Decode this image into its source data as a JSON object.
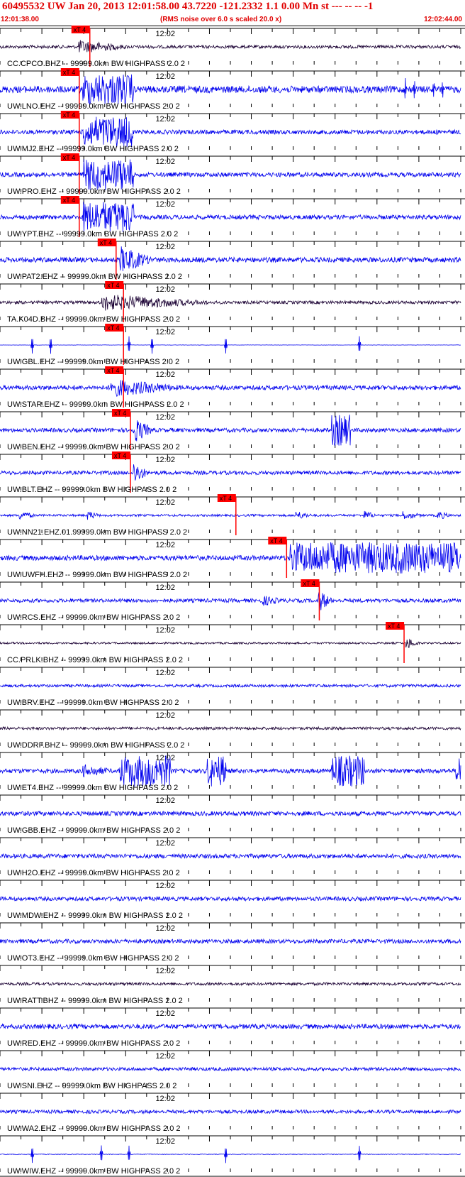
{
  "header": {
    "title": "60495532 UW Jan 20, 2013 12:01:58.00   43.7220 -121.2332  1.1 0.00 Mn st --- -- --   -1",
    "start_time": "12:01:38.00",
    "note": "(RMS noise over 6.0 s scaled 20.0 x)",
    "end_time": "12:02:44.00"
  },
  "colors": {
    "trace_blue": "#0000ee",
    "trace_dark": "#1a0033",
    "pick_red": "#ff0000",
    "header_red": "#e00000"
  },
  "chart_data": {
    "type": "line",
    "x_range": [
      "12:01:38.00",
      "12:02:44.00"
    ],
    "x_mid_label": "12:02",
    "pick_label": "xT 4",
    "channels": [
      {
        "label": "CC.CPCO.BHZ -- 99999.0km BW  HIGHPASS  2.0  2",
        "color": "dark",
        "pick": 0.195,
        "noise": 0.1,
        "bursts": [
          [
            0.17,
            0.28,
            0.45
          ]
        ]
      },
      {
        "label": "UW.LNO.EHZ -- 99999.0km BW  HIGHPASS  2.0  2",
        "color": "blue",
        "pick": 0.172,
        "noise": 0.22,
        "bursts": [
          [
            0.18,
            0.29,
            1.0
          ]
        ],
        "spikes": [
          0.88,
          0.9,
          0.94,
          0.96
        ]
      },
      {
        "label": "UW.MJ2.EHZ -- 99999.0km BW  HIGHPASS  2.0  2",
        "color": "blue",
        "pick": 0.172,
        "noise": 0.14,
        "bursts": [
          [
            0.18,
            0.29,
            1.0
          ]
        ]
      },
      {
        "label": "UW.PRO.EHZ -- 99999.0km BW  HIGHPASS  2.0  2",
        "color": "blue",
        "pick": 0.172,
        "noise": 0.14,
        "bursts": [
          [
            0.18,
            0.29,
            1.0
          ]
        ]
      },
      {
        "label": "UW.YPT.EHZ -- 99999.0km BW  HIGHPASS  2.0  2",
        "color": "blue",
        "pick": 0.172,
        "noise": 0.14,
        "bursts": [
          [
            0.18,
            0.29,
            1.0
          ]
        ]
      },
      {
        "label": "UW.PAT2.EHZ -- 99999.0km BW  HIGHPASS  2.0  2",
        "color": "blue",
        "pick": 0.252,
        "noise": 0.16,
        "bursts": [
          [
            0.26,
            0.33,
            0.9
          ]
        ]
      },
      {
        "label": "TA.K04D.BHZ -- 99999.0km BW  HIGHPASS  2.0  2",
        "color": "dark",
        "pick": 0.268,
        "noise": 0.1,
        "bursts": [
          [
            0.22,
            0.45,
            0.55
          ]
        ]
      },
      {
        "label": "UW.GBL.EHZ -- 99999.0km BW  HIGHPASS  2.0  2",
        "color": "blue",
        "pick": 0.268,
        "noise": 0.01,
        "spikes": [
          0.07,
          0.11,
          0.28,
          0.33,
          0.49,
          0.78
        ]
      },
      {
        "label": "UW.STAR.EHZ -- 99999.0km BW  HIGHPASS  2.0  2",
        "color": "blue",
        "pick": 0.268,
        "noise": 0.14,
        "bursts": [
          [
            0.24,
            0.4,
            0.6
          ]
        ]
      },
      {
        "label": "UW.BEN.EHZ -- 99999.0km BW  HIGHPASS  2.0  2",
        "color": "blue",
        "pick": 0.283,
        "noise": 0.13,
        "bursts": [
          [
            0.29,
            0.33,
            0.85
          ],
          [
            0.72,
            0.76,
            1.0
          ]
        ]
      },
      {
        "label": "UW.BLT.EHZ -- 99999.0km BW  HIGHPASS  2.0  2",
        "color": "blue",
        "pick": 0.283,
        "noise": 0.12,
        "bursts": [
          [
            0.29,
            0.32,
            0.75
          ]
        ]
      },
      {
        "label": "UW.NN21.EHZ.01.99999.0km BW  HIGHPASS  2.0  2",
        "color": "blue",
        "pick": 0.512,
        "noise": 0.07,
        "bursts": [
          [
            0.04,
            0.08,
            0.3
          ],
          [
            0.19,
            0.22,
            0.3
          ],
          [
            0.64,
            0.68,
            0.3
          ],
          [
            0.79,
            0.82,
            0.3
          ],
          [
            0.87,
            0.92,
            0.3
          ],
          [
            0.95,
            0.98,
            0.3
          ]
        ]
      },
      {
        "label": "UW.UWFH.EHZ -- 99999.0km BW  HIGHPASS  2.0  2",
        "color": "blue",
        "pick": 0.622,
        "noise": 0.16,
        "bursts": [
          [
            0.63,
            1.0,
            1.0
          ]
        ]
      },
      {
        "label": "UW.RCS.EHZ -- 99999.0km BW  HIGHPASS  2.0  2",
        "color": "blue",
        "pick": 0.693,
        "noise": 0.12,
        "bursts": [
          [
            0.57,
            0.62,
            0.35
          ],
          [
            0.69,
            0.72,
            0.75
          ]
        ]
      },
      {
        "label": "CC.PRLK.BHZ -- 99999.0km BW  HIGHPASS  2.0  2",
        "color": "dark",
        "pick": 0.877,
        "noise": 0.06,
        "bursts": [
          [
            0.88,
            0.91,
            0.4
          ]
        ]
      },
      {
        "label": "UW.BRV.EHZ -- 99999.0km BW  HIGHPASS  2.0  2",
        "color": "blue",
        "pick": null,
        "noise": 0.09
      },
      {
        "label": "UW.DDRF.BHZ -- 99999.0km BW  HIGHPASS  2.0  2",
        "color": "dark",
        "pick": null,
        "noise": 0.09
      },
      {
        "label": "UW.ET4.EHZ -- 99999.0km BW  HIGHPASS  2.0  2",
        "color": "blue",
        "pick": null,
        "noise": 0.14,
        "bursts": [
          [
            0.18,
            0.25,
            0.45
          ],
          [
            0.26,
            0.37,
            1.0
          ],
          [
            0.45,
            0.49,
            1.0
          ],
          [
            0.72,
            0.79,
            1.0
          ],
          [
            0.99,
            1.0,
            1.0
          ]
        ]
      },
      {
        "label": "UW.GBB.EHZ -- 99999.0km BW  HIGHPASS  2.0  2",
        "color": "blue",
        "pick": null,
        "noise": 0.14
      },
      {
        "label": "UW.H2O.EHZ -- 99999.0km BW  HIGHPASS  2.0  2",
        "color": "blue",
        "pick": null,
        "noise": 0.14
      },
      {
        "label": "UW.MDW.EHZ -- 99999.0km BW  HIGHPASS  2.0  2",
        "color": "blue",
        "pick": null,
        "noise": 0.13
      },
      {
        "label": "UW.OT3.EHZ -- 99999.0km BW  HIGHPASS  2.0  2",
        "color": "blue",
        "pick": null,
        "noise": 0.13
      },
      {
        "label": "UW.RATT.BHZ -- 99999.0km BW  HIGHPASS  2.0  2",
        "color": "dark",
        "pick": null,
        "noise": 0.09
      },
      {
        "label": "UW.RED.EHZ -- 99999.0km BW  HIGHPASS  2.0  2",
        "color": "blue",
        "pick": null,
        "noise": 0.15
      },
      {
        "label": "UW.SNI.EHZ -- 99999.0km BW  HIGHPASS  2.0  2",
        "color": "blue",
        "pick": null,
        "noise": 0.11
      },
      {
        "label": "UW.WA2.EHZ -- 99999.0km BW  HIGHPASS  2.0  2",
        "color": "blue",
        "pick": null,
        "noise": 0.11
      },
      {
        "label": "UW.WIW.EHZ -- 99999.0km BW  HIGHPASS  2.0  2",
        "color": "blue",
        "pick": null,
        "noise": 0.02,
        "spikes": [
          0.07,
          0.22,
          0.28,
          0.49,
          0.78
        ]
      }
    ]
  }
}
